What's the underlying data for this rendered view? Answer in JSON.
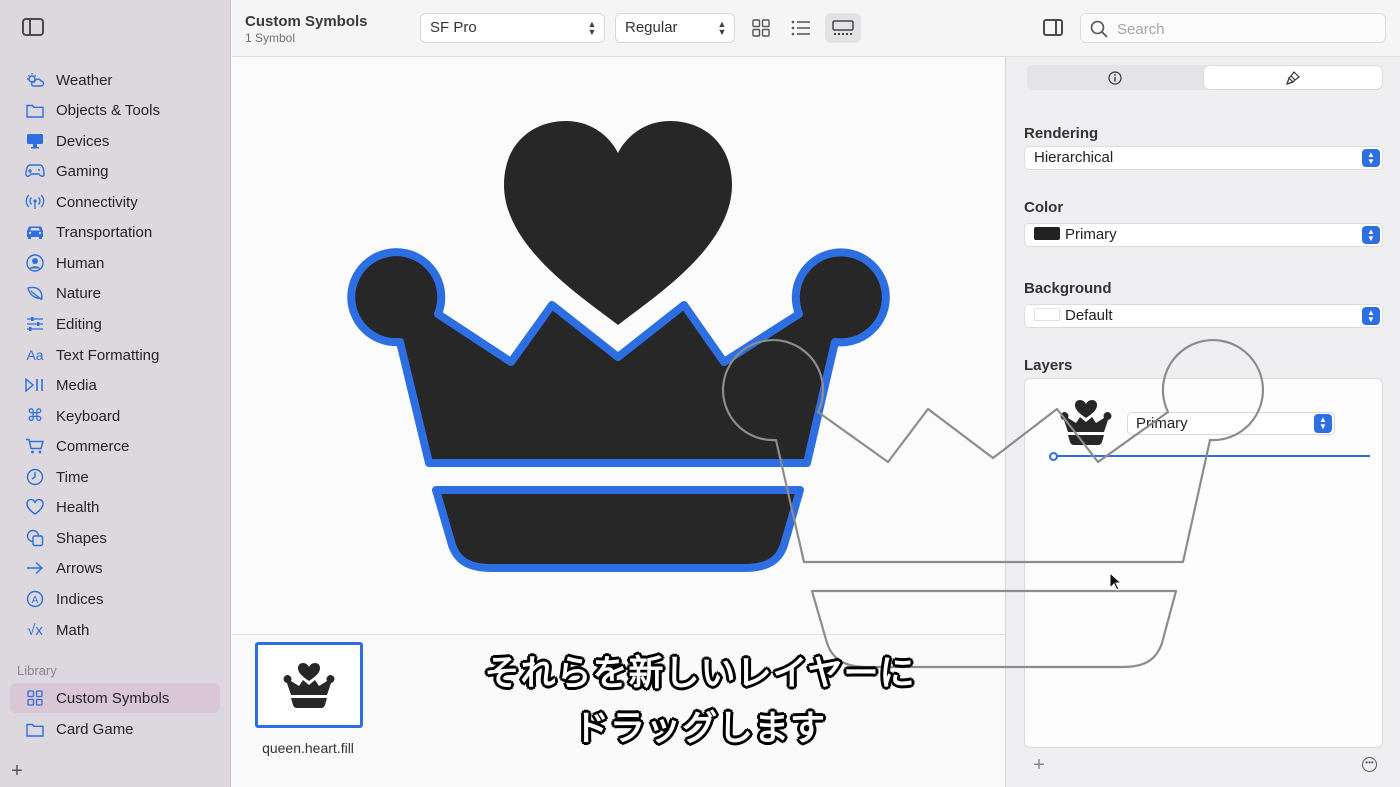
{
  "toolbar": {
    "title": "Custom Symbols",
    "subtitle": "1 Symbol",
    "font_popup": "SF Pro",
    "weight_popup": "Regular",
    "search_placeholder": "Search"
  },
  "sidebar": {
    "items": [
      {
        "label": "Weather",
        "icon": "cloud-sun-icon"
      },
      {
        "label": "Objects & Tools",
        "icon": "folder-icon"
      },
      {
        "label": "Devices",
        "icon": "desktop-icon"
      },
      {
        "label": "Gaming",
        "icon": "gamecontroller-icon"
      },
      {
        "label": "Connectivity",
        "icon": "antenna-icon"
      },
      {
        "label": "Transportation",
        "icon": "car-icon"
      },
      {
        "label": "Human",
        "icon": "person-circle-icon"
      },
      {
        "label": "Nature",
        "icon": "leaf-icon"
      },
      {
        "label": "Editing",
        "icon": "sliders-icon"
      },
      {
        "label": "Text Formatting",
        "icon": "textformat-icon"
      },
      {
        "label": "Media",
        "icon": "playpause-icon"
      },
      {
        "label": "Keyboard",
        "icon": "command-icon"
      },
      {
        "label": "Commerce",
        "icon": "cart-icon"
      },
      {
        "label": "Time",
        "icon": "clock-icon"
      },
      {
        "label": "Health",
        "icon": "heart-icon"
      },
      {
        "label": "Shapes",
        "icon": "shapes-icon"
      },
      {
        "label": "Arrows",
        "icon": "arrow-right-icon"
      },
      {
        "label": "Indices",
        "icon": "a-circle-icon"
      },
      {
        "label": "Math",
        "icon": "sqrt-icon"
      }
    ],
    "library_label": "Library",
    "library_items": [
      {
        "label": "Custom Symbols",
        "icon": "grid-icon",
        "selected": true
      },
      {
        "label": "Card Game",
        "icon": "folder-icon",
        "selected": false
      }
    ]
  },
  "gallery": {
    "symbol_name": "queen.heart.fill"
  },
  "inspector": {
    "rendering_label": "Rendering",
    "rendering_value": "Hierarchical",
    "color_label": "Color",
    "color_value": "Primary",
    "color_swatch": "#222222",
    "background_label": "Background",
    "background_value": "Default",
    "layers_label": "Layers",
    "layer_value": "Primary"
  },
  "subtitles": {
    "line1": "それらを新しいレイヤーに",
    "line2": "ドラッグします"
  },
  "colors": {
    "accent": "#2d6fe3",
    "symbol_fill": "#272727"
  }
}
